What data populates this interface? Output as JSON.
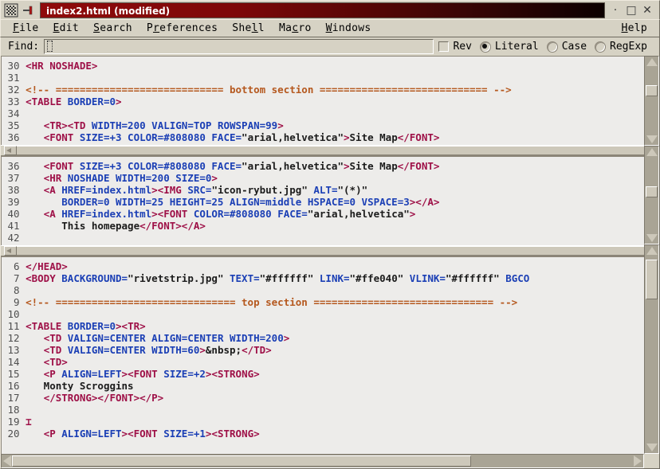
{
  "window": {
    "title": "index2.html (modified)",
    "icons": {
      "app": "editor-icon",
      "pin": "pin-icon",
      "minimize": "minimize-button",
      "maximize": "maximize-button",
      "close": "close-button"
    },
    "minimize_glyph": "·",
    "maximize_glyph": "□",
    "close_glyph": "✕"
  },
  "menubar": {
    "items": [
      {
        "label": "File",
        "mnemonic": "F"
      },
      {
        "label": "Edit",
        "mnemonic": "E"
      },
      {
        "label": "Search",
        "mnemonic": "S"
      },
      {
        "label": "Preferences",
        "mnemonic": "r"
      },
      {
        "label": "Shell",
        "mnemonic": "l"
      },
      {
        "label": "Macro",
        "mnemonic": "c"
      },
      {
        "label": "Windows",
        "mnemonic": "W"
      }
    ],
    "help": {
      "label": "Help",
      "mnemonic": "H"
    }
  },
  "findbar": {
    "label": "Find:",
    "value": "",
    "placeholder": "",
    "options": [
      {
        "label": "Rev",
        "type": "checkbox",
        "checked": false
      },
      {
        "label": "Literal",
        "type": "radio",
        "checked": true
      },
      {
        "label": "Case",
        "type": "radio",
        "checked": false
      },
      {
        "label": "RegExp",
        "type": "radio",
        "checked": false
      }
    ]
  },
  "colors": {
    "tag": "#9e1047",
    "attribute": "#1b3fb5",
    "comment": "#b5581e",
    "text": "#1b1b1b",
    "line_number": "#4f4f4f",
    "editor_background": "#edecea",
    "chrome": "#d6d2c4",
    "title_accent": "#8f0b0b"
  },
  "panes": [
    {
      "name": "pane-1",
      "first_line": 30,
      "lines": [
        {
          "num": "30",
          "spans": [
            {
              "t": "<HR NOSHADE>",
              "c": "tag"
            }
          ]
        },
        {
          "num": "31",
          "spans": []
        },
        {
          "num": "32",
          "spans": [
            {
              "t": "<!-- ============================ bottom section ============================ -->",
              "c": "comment"
            }
          ]
        },
        {
          "num": "33",
          "spans": [
            {
              "t": "<TABLE ",
              "c": "tag"
            },
            {
              "t": "BORDER=0",
              "c": "attr"
            },
            {
              "t": ">",
              "c": "tag"
            }
          ]
        },
        {
          "num": "34",
          "spans": []
        },
        {
          "num": "35",
          "spans": [
            {
              "t": "   ",
              "c": "plain"
            },
            {
              "t": "<TR><TD ",
              "c": "tag"
            },
            {
              "t": "WIDTH=200 VALIGN=TOP ROWSPAN=99",
              "c": "attr"
            },
            {
              "t": ">",
              "c": "tag"
            }
          ]
        },
        {
          "num": "36",
          "spans": [
            {
              "t": "   ",
              "c": "plain"
            },
            {
              "t": "<FONT ",
              "c": "tag"
            },
            {
              "t": "SIZE=+3 COLOR=#808080 FACE=",
              "c": "attr"
            },
            {
              "t": "\"arial,helvetica\"",
              "c": "val"
            },
            {
              "t": ">",
              "c": "tag"
            },
            {
              "t": "Site Map",
              "c": "txt"
            },
            {
              "t": "</FONT>",
              "c": "tag"
            }
          ]
        }
      ]
    },
    {
      "name": "pane-2",
      "first_line": 36,
      "lines": [
        {
          "num": "36",
          "spans": [
            {
              "t": "   ",
              "c": "plain"
            },
            {
              "t": "<FONT ",
              "c": "tag"
            },
            {
              "t": "SIZE=+3 COLOR=#808080 FACE=",
              "c": "attr"
            },
            {
              "t": "\"arial,helvetica\"",
              "c": "val"
            },
            {
              "t": ">",
              "c": "tag"
            },
            {
              "t": "Site Map",
              "c": "txt"
            },
            {
              "t": "</FONT>",
              "c": "tag"
            }
          ]
        },
        {
          "num": "37",
          "spans": [
            {
              "t": "   ",
              "c": "plain"
            },
            {
              "t": "<HR ",
              "c": "tag"
            },
            {
              "t": "NOSHADE WIDTH=200 SIZE=0",
              "c": "attr"
            },
            {
              "t": ">",
              "c": "tag"
            }
          ]
        },
        {
          "num": "38",
          "spans": [
            {
              "t": "   ",
              "c": "plain"
            },
            {
              "t": "<A ",
              "c": "tag"
            },
            {
              "t": "HREF=index.html",
              "c": "attr"
            },
            {
              "t": ">",
              "c": "tag"
            },
            {
              "t": "<IMG ",
              "c": "tag"
            },
            {
              "t": "SRC=",
              "c": "attr"
            },
            {
              "t": "\"icon-rybut.jpg\"",
              "c": "val"
            },
            {
              "t": " ALT=",
              "c": "attr"
            },
            {
              "t": "\"(*)\"",
              "c": "val"
            }
          ]
        },
        {
          "num": "39",
          "spans": [
            {
              "t": "      ",
              "c": "plain"
            },
            {
              "t": "BORDER=0 WIDTH=25 HEIGHT=25 ALIGN=middle HSPACE=0 VSPACE=3",
              "c": "attr"
            },
            {
              "t": ">",
              "c": "tag"
            },
            {
              "t": "</A>",
              "c": "tag"
            }
          ]
        },
        {
          "num": "40",
          "spans": [
            {
              "t": "   ",
              "c": "plain"
            },
            {
              "t": "<A ",
              "c": "tag"
            },
            {
              "t": "HREF=index.html",
              "c": "attr"
            },
            {
              "t": ">",
              "c": "tag"
            },
            {
              "t": "<FONT ",
              "c": "tag"
            },
            {
              "t": "COLOR=#808080 FACE=",
              "c": "attr"
            },
            {
              "t": "\"arial,helvetica\"",
              "c": "val"
            },
            {
              "t": ">",
              "c": "tag"
            }
          ]
        },
        {
          "num": "41",
          "spans": [
            {
              "t": "      This homepage",
              "c": "txt"
            },
            {
              "t": "</FONT></A>",
              "c": "tag"
            }
          ]
        },
        {
          "num": "42",
          "spans": []
        }
      ]
    },
    {
      "name": "pane-3",
      "first_line": 6,
      "cursor_line": "19",
      "lines": [
        {
          "num": " 6",
          "spans": [
            {
              "t": "</HEAD>",
              "c": "tag"
            }
          ]
        },
        {
          "num": " 7",
          "spans": [
            {
              "t": "<BODY ",
              "c": "tag"
            },
            {
              "t": "BACKGROUND=",
              "c": "attr"
            },
            {
              "t": "\"rivetstrip.jpg\"",
              "c": "val"
            },
            {
              "t": " TEXT=",
              "c": "attr"
            },
            {
              "t": "\"#ffffff\"",
              "c": "val"
            },
            {
              "t": " LINK=",
              "c": "attr"
            },
            {
              "t": "\"#ffe040\"",
              "c": "val"
            },
            {
              "t": " VLINK=",
              "c": "attr"
            },
            {
              "t": "\"#ffffff\"",
              "c": "val"
            },
            {
              "t": " BGCO",
              "c": "attr"
            }
          ]
        },
        {
          "num": " 8",
          "spans": []
        },
        {
          "num": " 9",
          "spans": [
            {
              "t": "<!-- ============================== top section ============================== -->",
              "c": "comment"
            }
          ]
        },
        {
          "num": "10",
          "spans": []
        },
        {
          "num": "11",
          "spans": [
            {
              "t": "<TABLE ",
              "c": "tag"
            },
            {
              "t": "BORDER=0",
              "c": "attr"
            },
            {
              "t": ">",
              "c": "tag"
            },
            {
              "t": "<TR>",
              "c": "tag"
            }
          ]
        },
        {
          "num": "12",
          "spans": [
            {
              "t": "   ",
              "c": "plain"
            },
            {
              "t": "<TD ",
              "c": "tag"
            },
            {
              "t": "VALIGN=CENTER ALIGN=CENTER WIDTH=200",
              "c": "attr"
            },
            {
              "t": ">",
              "c": "tag"
            }
          ]
        },
        {
          "num": "13",
          "spans": [
            {
              "t": "   ",
              "c": "plain"
            },
            {
              "t": "<TD ",
              "c": "tag"
            },
            {
              "t": "VALIGN=CENTER WIDTH=60",
              "c": "attr"
            },
            {
              "t": ">",
              "c": "tag"
            },
            {
              "t": "&nbsp;",
              "c": "txt"
            },
            {
              "t": "</TD>",
              "c": "tag"
            }
          ]
        },
        {
          "num": "14",
          "spans": [
            {
              "t": "   ",
              "c": "plain"
            },
            {
              "t": "<TD>",
              "c": "tag"
            }
          ]
        },
        {
          "num": "15",
          "spans": [
            {
              "t": "   ",
              "c": "plain"
            },
            {
              "t": "<P ",
              "c": "tag"
            },
            {
              "t": "ALIGN=LEFT",
              "c": "attr"
            },
            {
              "t": ">",
              "c": "tag"
            },
            {
              "t": "<FONT ",
              "c": "tag"
            },
            {
              "t": "SIZE=+2",
              "c": "attr"
            },
            {
              "t": ">",
              "c": "tag"
            },
            {
              "t": "<STRONG>",
              "c": "tag"
            }
          ]
        },
        {
          "num": "16",
          "spans": [
            {
              "t": "   Monty Scroggins",
              "c": "txt"
            }
          ]
        },
        {
          "num": "17",
          "spans": [
            {
              "t": "   ",
              "c": "plain"
            },
            {
              "t": "</STRONG></FONT></P>",
              "c": "tag"
            }
          ]
        },
        {
          "num": "18",
          "spans": []
        },
        {
          "num": "19",
          "spans": [
            {
              "t": "⌶",
              "c": "cursor-ibeam"
            }
          ]
        },
        {
          "num": "20",
          "spans": [
            {
              "t": "   ",
              "c": "plain"
            },
            {
              "t": "<P ",
              "c": "tag"
            },
            {
              "t": "ALIGN=LEFT",
              "c": "attr"
            },
            {
              "t": ">",
              "c": "tag"
            },
            {
              "t": "<FONT ",
              "c": "tag"
            },
            {
              "t": "SIZE=+1",
              "c": "attr"
            },
            {
              "t": ">",
              "c": "tag"
            },
            {
              "t": "<STRONG>",
              "c": "tag"
            }
          ]
        }
      ]
    }
  ],
  "scrollbars": {
    "vertical": [
      {
        "name": "vscrollbar-pane-1",
        "thumb_top_pct": 28,
        "thumb_height_pct": 14
      },
      {
        "name": "vscrollbar-pane-2",
        "thumb_top_pct": 40,
        "thumb_height_pct": 16
      },
      {
        "name": "vscrollbar-pane-3",
        "thumb_top_pct": 8,
        "thumb_height_pct": 22
      }
    ],
    "horizontal": {
      "name": "hscrollbar",
      "thumb_left_pct": 1,
      "thumb_width_pct": 74
    }
  }
}
